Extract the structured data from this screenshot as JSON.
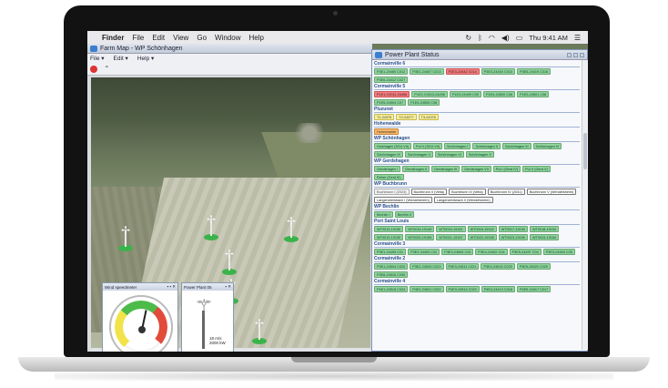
{
  "menubar": {
    "items": [
      "Finder",
      "File",
      "Edit",
      "View",
      "Go",
      "Window",
      "Help"
    ],
    "clock": "Thu 9:41 AM"
  },
  "farm_window": {
    "title": "Farm Map - WP Schönhagen",
    "menu": [
      "File ▾",
      "Edit ▾",
      "Help ▾"
    ]
  },
  "speed_widget": {
    "title": "Wind speedmeter",
    "ticks": [
      "0",
      "5",
      "10",
      "15",
      "20",
      "25"
    ]
  },
  "power_widget": {
    "title": "Power Plant 05",
    "speed": "18 m/s",
    "power": "2000 kW"
  },
  "status_window": {
    "title": "Power Plant Status",
    "groups": [
      {
        "name": "Cormainville 6",
        "chips": [
          {
            "l": "P3E1-24450 C012",
            "c": "green"
          },
          {
            "l": "P3E2-24457 C013",
            "c": "green"
          },
          {
            "l": "P2E3-24442 C014",
            "c": "red"
          },
          {
            "l": "P3E3-24454 C015",
            "c": "green"
          },
          {
            "l": "P3E5-24419 C016",
            "c": "green"
          },
          {
            "l": "P3E6-24412 C027",
            "c": "green"
          }
        ]
      },
      {
        "name": "Cormainville 5",
        "chips": [
          {
            "l": "P1E1-C0011-24496",
            "c": "red"
          },
          {
            "l": "P1E2-C0013-24496",
            "c": "green"
          },
          {
            "l": "P1E3-24499 C05",
            "c": "green"
          },
          {
            "l": "P1E4-24500 C06",
            "c": "green"
          },
          {
            "l": "P1E5-24501 C06",
            "c": "green"
          },
          {
            "l": "P1E5-24504 C07",
            "c": "green"
          },
          {
            "l": "P1E6-24505 C08",
            "c": "green"
          }
        ]
      },
      {
        "name": "Pluzunet",
        "chips": [
          {
            "l": "T1-24376",
            "c": "yellow"
          },
          {
            "l": "T2-24377",
            "c": "yellow"
          },
          {
            "l": "T3-24378",
            "c": "yellow"
          }
        ]
      },
      {
        "name": "Hohenwalde",
        "chips": [
          {
            "l": "Hohenwalde",
            "c": "orange"
          }
        ]
      },
      {
        "name": "WP Schönhagen",
        "chips": [
          {
            "l": "Holzhagen (SG4 VII)",
            "c": "green"
          },
          {
            "l": "Pul V (SG4 VII)",
            "c": "green"
          },
          {
            "l": "Schönhagen I",
            "c": "green"
          },
          {
            "l": "Schönhagen II",
            "c": "green"
          },
          {
            "l": "Schönhagen III",
            "c": "green"
          },
          {
            "l": "Schönhagen IV",
            "c": "green"
          },
          {
            "l": "Schönhagen IX",
            "c": "green"
          },
          {
            "l": "Schönhagen V",
            "c": "green"
          },
          {
            "l": "Schönhagen VI",
            "c": "green"
          },
          {
            "l": "Schönhagen X",
            "c": "green"
          }
        ]
      },
      {
        "name": "WP Gerdshagen",
        "chips": [
          {
            "l": "Gerdshagen I",
            "c": "green"
          },
          {
            "l": "Gerdshagen II",
            "c": "green"
          },
          {
            "l": "Gerdshagen III",
            "c": "green"
          },
          {
            "l": "Gerdshagen VII",
            "c": "green"
          },
          {
            "l": "Pul I (Gerd IV)",
            "c": "green"
          },
          {
            "l": "Pul V (Gerd V)",
            "c": "green"
          },
          {
            "l": "Reher (Gerd III)",
            "c": "green"
          }
        ]
      },
      {
        "name": "WP Buchbrunn",
        "chips": [
          {
            "l": "Buchbrunn I (2024)",
            "c": "grey"
          },
          {
            "l": "Buchbrunn II (Velta)",
            "c": "white"
          },
          {
            "l": "Buchbrunn III (Velta)",
            "c": "white"
          },
          {
            "l": "Buchbrunn IV (2041)",
            "c": "white"
          },
          {
            "l": "Buchbrunn V (Wendelsheim)",
            "c": "white"
          },
          {
            "l": "Langendreisbach I (Wendelsheim)",
            "c": "white"
          },
          {
            "l": "Langendreisbach II (Wendelsheim)",
            "c": "white"
          }
        ]
      },
      {
        "name": "WP Bechlin",
        "chips": [
          {
            "l": "Bechlin I",
            "c": "green"
          },
          {
            "l": "Bechlin II",
            "c": "green"
          }
        ]
      },
      {
        "name": "Port Saint Louis",
        "chips": [
          {
            "l": "WT0013-19150",
            "c": "green"
          },
          {
            "l": "WT0014-19149",
            "c": "green"
          },
          {
            "l": "WT0015-19151",
            "c": "green"
          },
          {
            "l": "WT0016-19152",
            "c": "green"
          },
          {
            "l": "WT0017-19153",
            "c": "green"
          },
          {
            "l": "WT0018-19154",
            "c": "green"
          },
          {
            "l": "WT0019-19155",
            "c": "green"
          },
          {
            "l": "WT0020-19156",
            "c": "green"
          },
          {
            "l": "WT0021-19157",
            "c": "green"
          },
          {
            "l": "WT0022-19158",
            "c": "green"
          },
          {
            "l": "WT0023-19159",
            "c": "green"
          },
          {
            "l": "WT0024-19160",
            "c": "green"
          }
        ]
      },
      {
        "name": "Cormainville 3",
        "chips": [
          {
            "l": "P3E1-24495 C01",
            "c": "green"
          },
          {
            "l": "P3E2-24493 C02",
            "c": "green"
          },
          {
            "l": "P3E3-24506 C03",
            "c": "green"
          },
          {
            "l": "P3E4-24492 C04",
            "c": "green"
          },
          {
            "l": "P3E5-24497 C04",
            "c": "green"
          },
          {
            "l": "P3E3-24500 C05",
            "c": "green"
          }
        ]
      },
      {
        "name": "Cormainville 2",
        "chips": [
          {
            "l": "P3E1-24504 C020",
            "c": "green"
          },
          {
            "l": "P3E2-24533 C023",
            "c": "green"
          },
          {
            "l": "P3E3-24511 C021",
            "c": "green"
          },
          {
            "l": "P3E4-24515 C025",
            "c": "green"
          },
          {
            "l": "P3E5-24520 C029",
            "c": "green"
          },
          {
            "l": "P3E6-24516 C030",
            "c": "green"
          }
        ]
      },
      {
        "name": "Cormainville 4",
        "chips": [
          {
            "l": "P4E1-24518 C024",
            "c": "green"
          },
          {
            "l": "P4E2-24521 C022",
            "c": "green"
          },
          {
            "l": "P4E3-24514 C020",
            "c": "green"
          },
          {
            "l": "P4E4-24413 C018",
            "c": "green"
          },
          {
            "l": "P4E5-24417 C017",
            "c": "green"
          }
        ]
      }
    ]
  }
}
